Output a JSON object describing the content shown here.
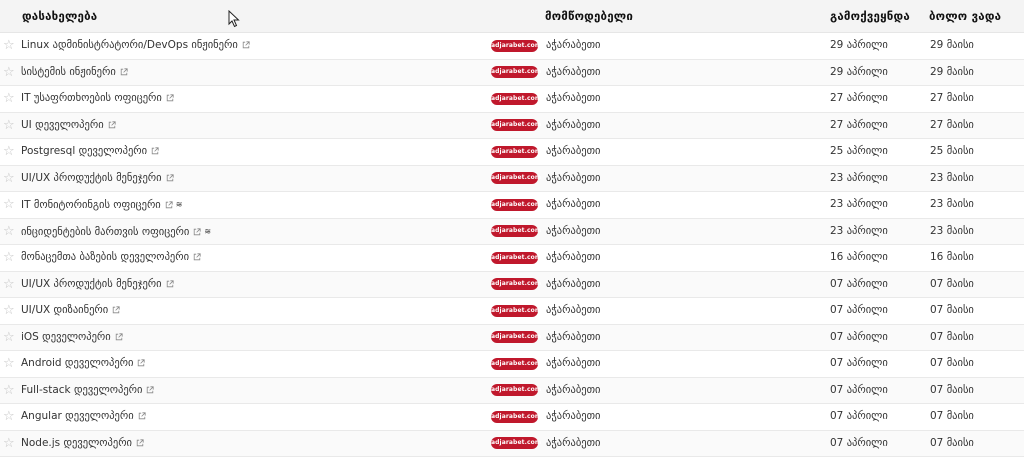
{
  "header": {
    "title": "დასახელება",
    "company": "მომწოდებელი",
    "published": "გამოქვეყნდა",
    "deadline": "ბოლო ვადა"
  },
  "colors": {
    "logo_bg": "#c0182c",
    "header_bg": "#f4f4f4"
  },
  "rows": [
    {
      "title": "Linux ადმინისტრატორი/DevOps ინჟინერი",
      "logo": "adjarabet.com",
      "company": "აჭარაბეთი",
      "published": "29 აპრილი",
      "deadline": "29 მაისი",
      "extra_icon": ""
    },
    {
      "title": "სისტემის ინჟინერი",
      "logo": "adjarabet.com",
      "company": "აჭარაბეთი",
      "published": "29 აპრილი",
      "deadline": "29 მაისი",
      "extra_icon": ""
    },
    {
      "title": "IT უსაფრთხოების ოფიცერი",
      "logo": "adjarabet.com",
      "company": "აჭარაბეთი",
      "published": "27 აპრილი",
      "deadline": "27 მაისი",
      "extra_icon": ""
    },
    {
      "title": "UI დეველოპერი",
      "logo": "adjarabet.com",
      "company": "აჭარაბეთი",
      "published": "27 აპრილი",
      "deadline": "27 მაისი",
      "extra_icon": ""
    },
    {
      "title": "Postgresql დეველოპერი",
      "logo": "adjarabet.com",
      "company": "აჭარაბეთი",
      "published": "25 აპრილი",
      "deadline": "25 მაისი",
      "extra_icon": ""
    },
    {
      "title": "UI/UX პროდუქტის მენეჯერი",
      "logo": "adjarabet.com",
      "company": "აჭარაბეთი",
      "published": "23 აპრილი",
      "deadline": "23 მაისი",
      "extra_icon": ""
    },
    {
      "title": "IT მონიტორინგის ოფიცერი",
      "logo": "adjarabet.com",
      "company": "აჭარაბეთი",
      "published": "23 აპრილი",
      "deadline": "23 მაისი",
      "extra_icon": "≋"
    },
    {
      "title": "ინციდენტების მართვის ოფიცერი",
      "logo": "adjarabet.com",
      "company": "აჭარაბეთი",
      "published": "23 აპრილი",
      "deadline": "23 მაისი",
      "extra_icon": "≋"
    },
    {
      "title": "მონაცემთა ბაზების დეველოპერი",
      "logo": "adjarabet.com",
      "company": "აჭარაბეთი",
      "published": "16 აპრილი",
      "deadline": "16 მაისი",
      "extra_icon": ""
    },
    {
      "title": "UI/UX პროდუქტის მენეჯერი",
      "logo": "adjarabet.com",
      "company": "აჭარაბეთი",
      "published": "07 აპრილი",
      "deadline": "07 მაისი",
      "extra_icon": ""
    },
    {
      "title": "UI/UX დიზაინერი",
      "logo": "adjarabet.com",
      "company": "აჭარაბეთი",
      "published": "07 აპრილი",
      "deadline": "07 მაისი",
      "extra_icon": ""
    },
    {
      "title": "iOS დეველოპერი",
      "logo": "adjarabet.com",
      "company": "აჭარაბეთი",
      "published": "07 აპრილი",
      "deadline": "07 მაისი",
      "extra_icon": ""
    },
    {
      "title": "Android დეველოპერი",
      "logo": "adjarabet.com",
      "company": "აჭარაბეთი",
      "published": "07 აპრილი",
      "deadline": "07 მაისი",
      "extra_icon": ""
    },
    {
      "title": "Full-stack დეველოპერი",
      "logo": "adjarabet.com",
      "company": "აჭარაბეთი",
      "published": "07 აპრილი",
      "deadline": "07 მაისი",
      "extra_icon": ""
    },
    {
      "title": "Angular დეველოპერი",
      "logo": "adjarabet.com",
      "company": "აჭარაბეთი",
      "published": "07 აპრილი",
      "deadline": "07 მაისი",
      "extra_icon": ""
    },
    {
      "title": "Node.js დეველოპერი",
      "logo": "adjarabet.com",
      "company": "აჭარაბეთი",
      "published": "07 აპრილი",
      "deadline": "07 მაისი",
      "extra_icon": ""
    }
  ]
}
